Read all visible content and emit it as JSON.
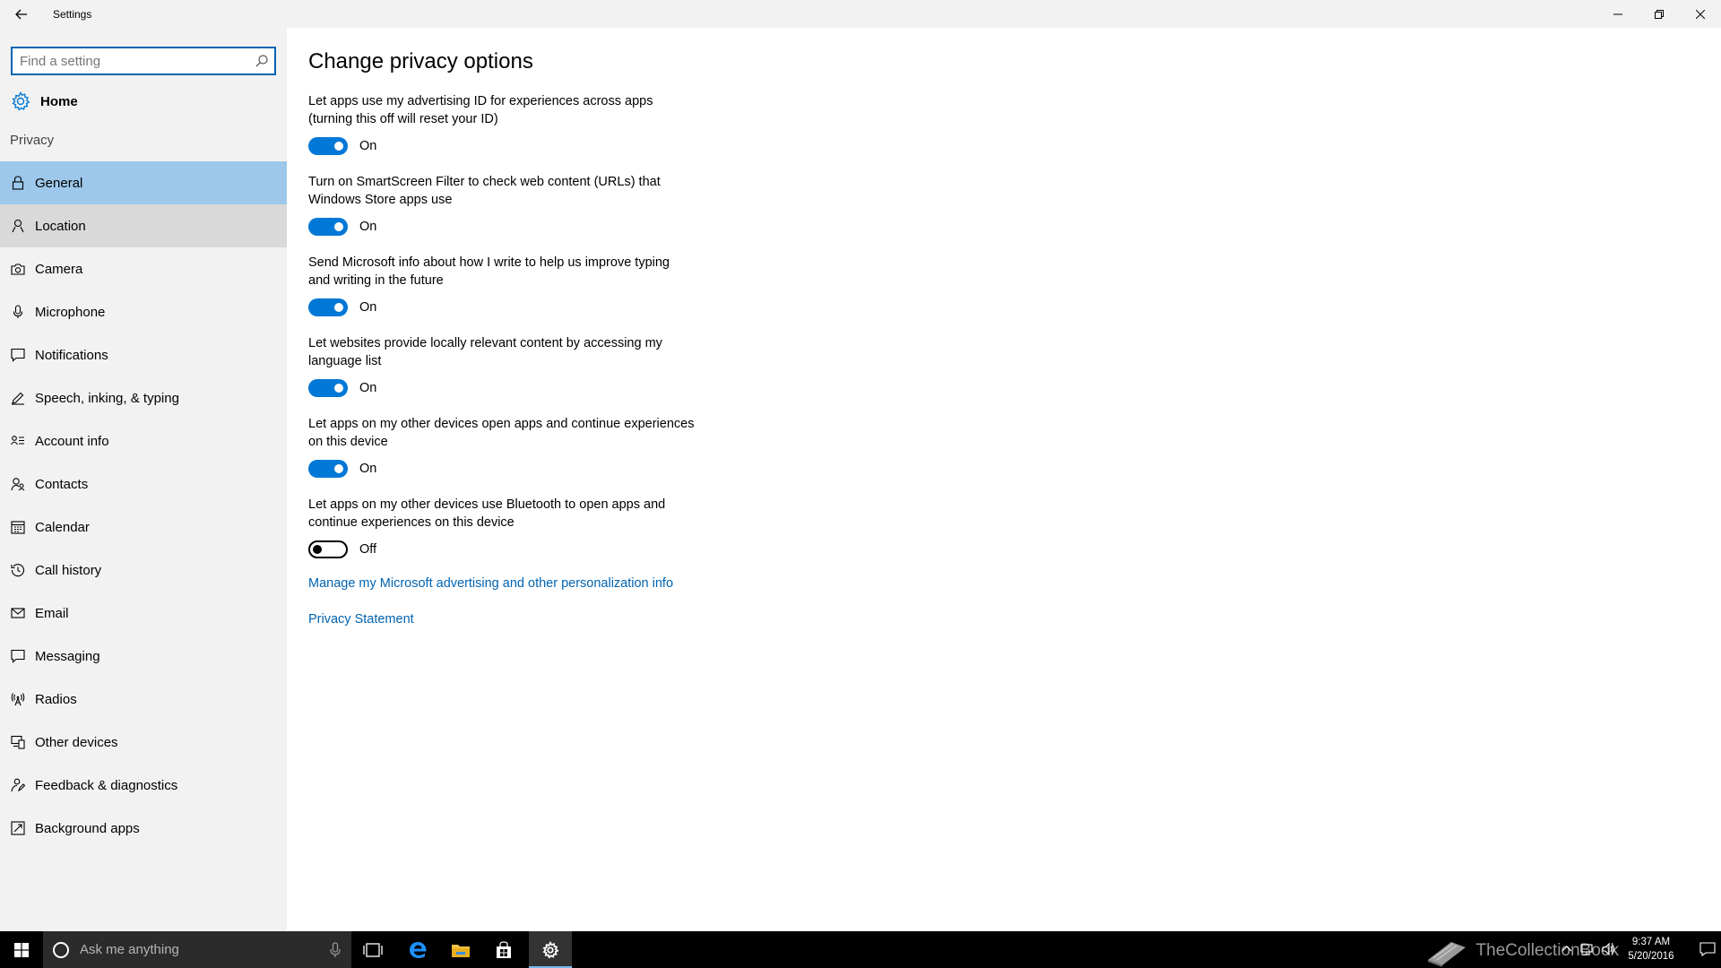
{
  "window": {
    "title": "Settings"
  },
  "search": {
    "placeholder": "Find a setting"
  },
  "home": {
    "label": "Home"
  },
  "section": {
    "label": "Privacy"
  },
  "nav": [
    {
      "label": "General",
      "icon": "lock-icon",
      "state": "selected"
    },
    {
      "label": "Location",
      "icon": "location-icon",
      "state": "hover"
    },
    {
      "label": "Camera",
      "icon": "camera-icon",
      "state": ""
    },
    {
      "label": "Microphone",
      "icon": "microphone-icon",
      "state": ""
    },
    {
      "label": "Notifications",
      "icon": "notifications-icon",
      "state": ""
    },
    {
      "label": "Speech, inking, & typing",
      "icon": "speech-icon",
      "state": ""
    },
    {
      "label": "Account info",
      "icon": "account-info-icon",
      "state": ""
    },
    {
      "label": "Contacts",
      "icon": "contacts-icon",
      "state": ""
    },
    {
      "label": "Calendar",
      "icon": "calendar-icon",
      "state": ""
    },
    {
      "label": "Call history",
      "icon": "call-history-icon",
      "state": ""
    },
    {
      "label": "Email",
      "icon": "email-icon",
      "state": ""
    },
    {
      "label": "Messaging",
      "icon": "messaging-icon",
      "state": ""
    },
    {
      "label": "Radios",
      "icon": "radios-icon",
      "state": ""
    },
    {
      "label": "Other devices",
      "icon": "other-devices-icon",
      "state": ""
    },
    {
      "label": "Feedback & diagnostics",
      "icon": "feedback-icon",
      "state": ""
    },
    {
      "label": "Background apps",
      "icon": "background-apps-icon",
      "state": ""
    }
  ],
  "main": {
    "title": "Change privacy options",
    "settings": [
      {
        "line1": "Let apps use my advertising ID for experiences across apps",
        "line2": "(turning this off will reset your ID)",
        "state": "On"
      },
      {
        "line1": "Turn on SmartScreen Filter to check web content (URLs) that",
        "line2": "Windows Store apps use",
        "state": "On"
      },
      {
        "line1": "Send Microsoft info about how I write to help us improve typing",
        "line2": "and writing in the future",
        "state": "On"
      },
      {
        "line1": "Let websites provide locally relevant content by accessing my",
        "line2": "language list",
        "state": "On"
      },
      {
        "line1": "Let apps on my other devices open apps and continue experiences",
        "line2": "on this device",
        "state": "On"
      },
      {
        "line1": "Let apps on my other devices use Bluetooth to open apps and",
        "line2": "continue experiences on this device",
        "state": "Off"
      }
    ],
    "links": {
      "advertising": "Manage my Microsoft advertising and other personalization info",
      "privacy": "Privacy Statement"
    }
  },
  "taskbar": {
    "cortana_placeholder": "Ask me anything",
    "watermark": "TheCollectionBook",
    "time": "9:37 AM",
    "date": "5/20/2016"
  },
  "colors": {
    "accent": "#0078d7",
    "selected": "#9dc8eb",
    "link": "#0063b1"
  }
}
